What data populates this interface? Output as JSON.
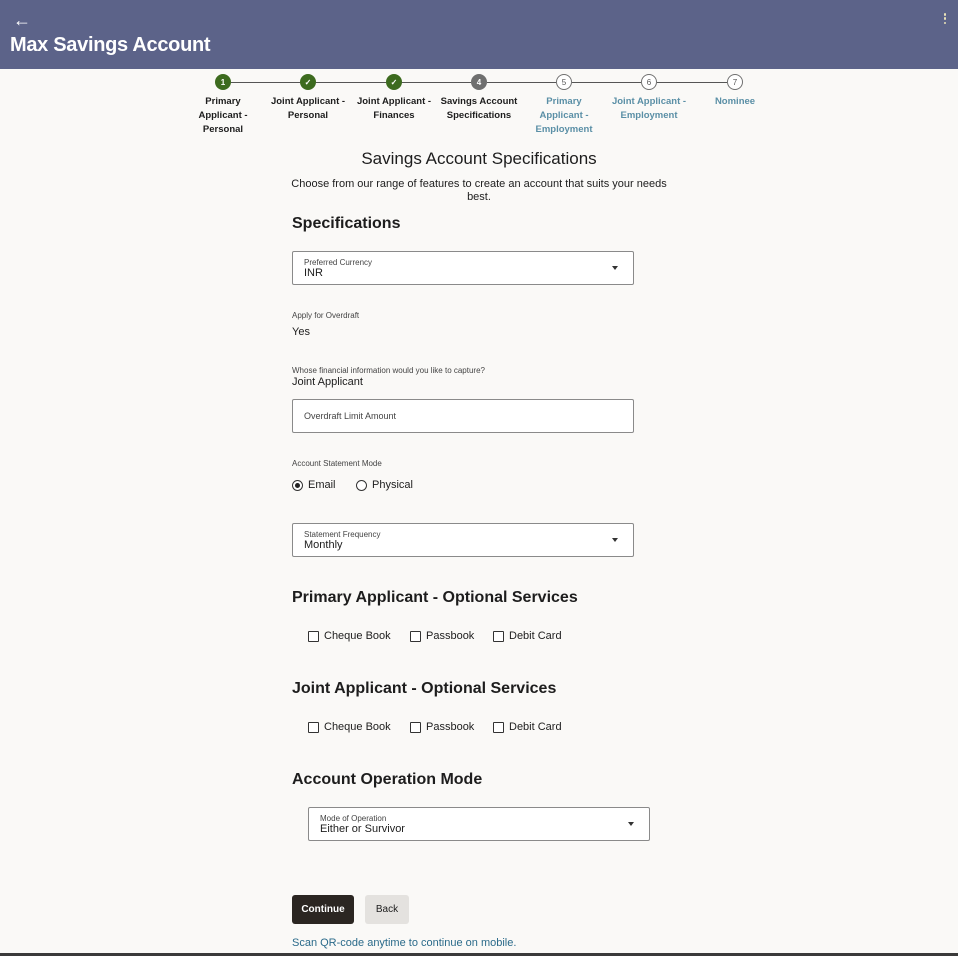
{
  "header": {
    "title": "Max Savings Account",
    "back_icon": "←",
    "menu_icon": "kebab-menu-icon"
  },
  "stepper": {
    "steps": [
      {
        "marker": "1",
        "label_lines": [
          "Primary",
          "Applicant -",
          "Personal"
        ],
        "state": "done"
      },
      {
        "marker": "✓",
        "label_lines": [
          "Joint Applicant -",
          "Personal"
        ],
        "state": "done"
      },
      {
        "marker": "✓",
        "label_lines": [
          "Joint Applicant -",
          "Finances"
        ],
        "state": "done"
      },
      {
        "marker": "4",
        "label_lines": [
          "Savings Account",
          "Specifications"
        ],
        "state": "current"
      },
      {
        "marker": "5",
        "label_lines": [
          "Primary",
          "Applicant -",
          "Employment"
        ],
        "state": "todo"
      },
      {
        "marker": "6",
        "label_lines": [
          "Joint Applicant -",
          "Employment"
        ],
        "state": "todo"
      },
      {
        "marker": "7",
        "label_lines": [
          "Nominee"
        ],
        "state": "todo"
      }
    ]
  },
  "page": {
    "heading": "Savings Account Specifications",
    "subheading": "Choose from our range of features to create an account that suits your needs best."
  },
  "specifications": {
    "title": "Specifications",
    "currency_label": "Preferred Currency",
    "currency_value": "INR",
    "overdraft_label": "Apply for Overdraft",
    "overdraft_value": "Yes",
    "financial_info_label": "Whose financial information would you like to capture?",
    "financial_info_value": "Joint Applicant",
    "overdraft_limit_placeholder": "Overdraft Limit Amount",
    "statement_mode_label": "Account Statement Mode",
    "statement_mode_options": [
      "Email",
      "Physical"
    ],
    "statement_mode_selected": "Email",
    "frequency_label": "Statement Frequency",
    "frequency_value": "Monthly"
  },
  "primary_services": {
    "title": "Primary Applicant - Optional Services",
    "options": [
      "Cheque Book",
      "Passbook",
      "Debit Card"
    ]
  },
  "joint_services": {
    "title": "Joint Applicant - Optional Services",
    "options": [
      "Cheque Book",
      "Passbook",
      "Debit Card"
    ]
  },
  "operation_mode": {
    "title": "Account Operation Mode",
    "label": "Mode of Operation",
    "value": "Either or Survivor"
  },
  "actions": {
    "continue_label": "Continue",
    "back_label": "Back",
    "qr_text": "Scan QR-code anytime to continue on mobile."
  }
}
